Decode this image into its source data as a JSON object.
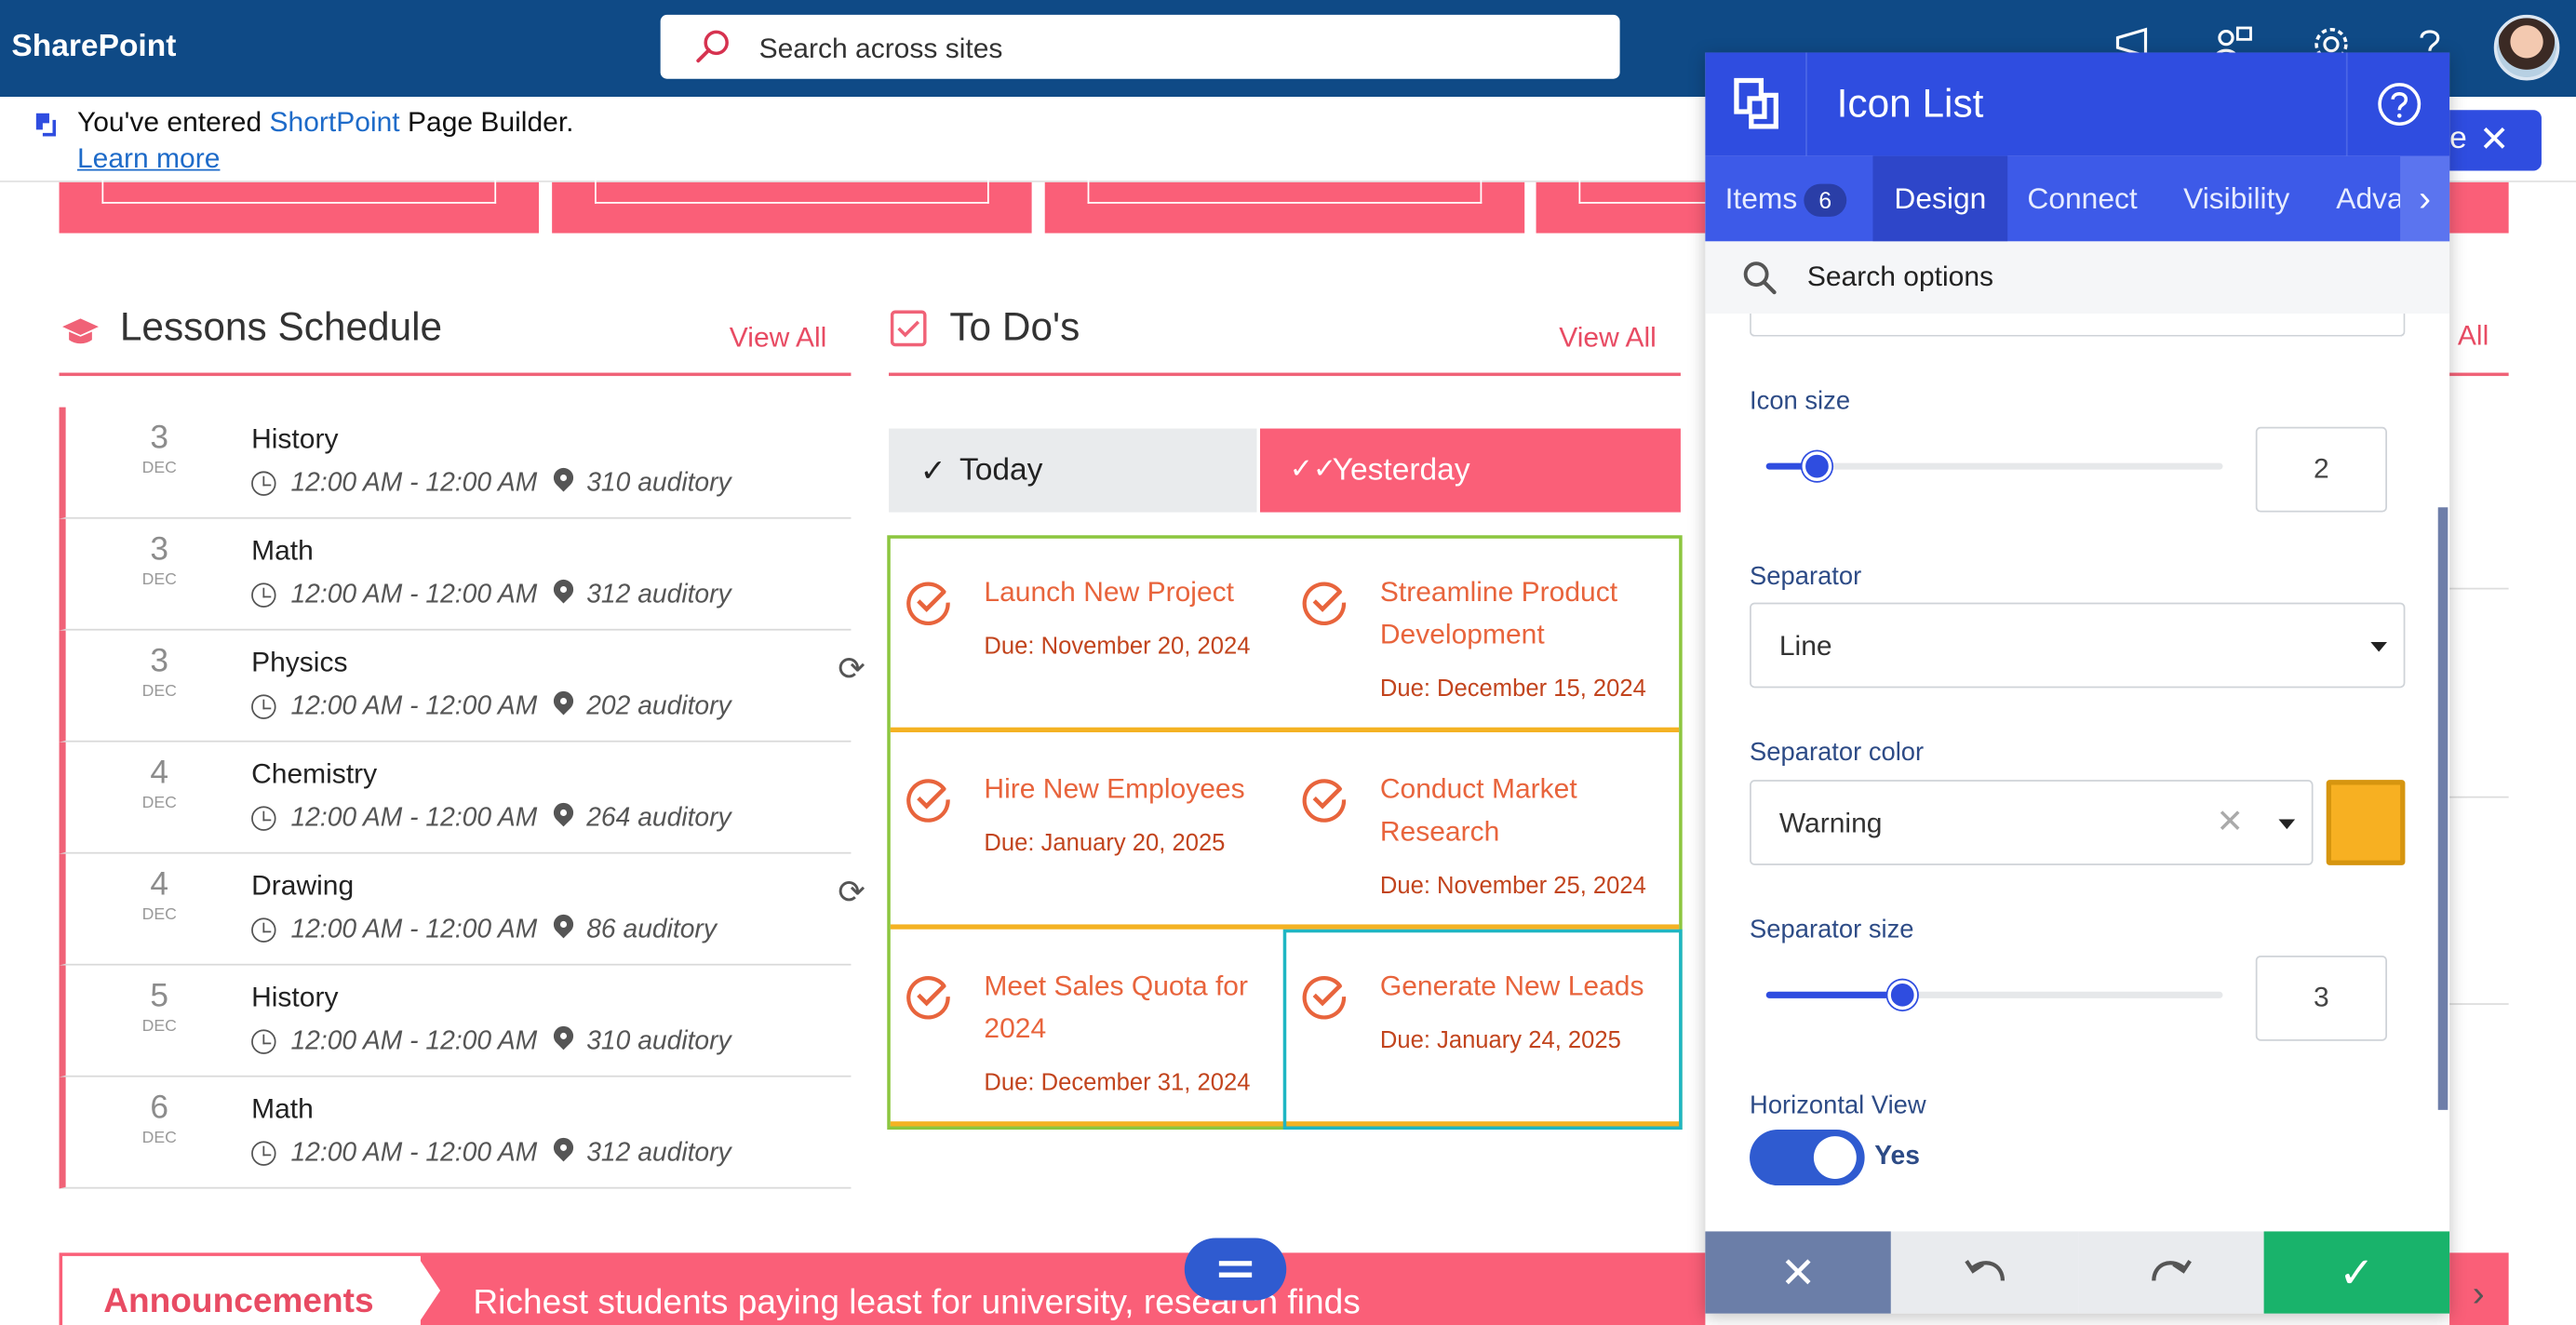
{
  "topbar": {
    "brand": "SharePoint",
    "search_placeholder": "Search across sites"
  },
  "notice": {
    "prefix": "You've entered ",
    "product": "ShortPoint",
    "suffix": " Page Builder.",
    "learn_more": "Learn more"
  },
  "lessons": {
    "title": "Lessons Schedule",
    "view_all": "View All",
    "items": [
      {
        "day": "3",
        "month": "DEC",
        "subject": "History",
        "time": "12:00 AM - 12:00 AM",
        "room": "310 auditory",
        "recurring": false
      },
      {
        "day": "3",
        "month": "DEC",
        "subject": "Math",
        "time": "12:00 AM - 12:00 AM",
        "room": "312 auditory",
        "recurring": false
      },
      {
        "day": "3",
        "month": "DEC",
        "subject": "Physics",
        "time": "12:00 AM - 12:00 AM",
        "room": "202 auditory",
        "recurring": true
      },
      {
        "day": "4",
        "month": "DEC",
        "subject": "Chemistry",
        "time": "12:00 AM - 12:00 AM",
        "room": "264 auditory",
        "recurring": false
      },
      {
        "day": "4",
        "month": "DEC",
        "subject": "Drawing",
        "time": "12:00 AM - 12:00 AM",
        "room": "86 auditory",
        "recurring": true
      },
      {
        "day": "5",
        "month": "DEC",
        "subject": "History",
        "time": "12:00 AM - 12:00 AM",
        "room": "310 auditory",
        "recurring": false
      },
      {
        "day": "6",
        "month": "DEC",
        "subject": "Math",
        "time": "12:00 AM - 12:00 AM",
        "room": "312 auditory",
        "recurring": false
      }
    ]
  },
  "todos": {
    "title": "To Do's",
    "view_all": "View All",
    "tab_today": "Today",
    "tab_yesterday": "Yesterday",
    "items": [
      {
        "title": "Launch New Project",
        "due": "Due: November 20, 2024"
      },
      {
        "title": "Streamline Product Development",
        "due": "Due: December 15, 2024"
      },
      {
        "title": "Hire New Employees",
        "due": "Due: January 20, 2025"
      },
      {
        "title": "Conduct Market Research",
        "due": "Due: November 25, 2024"
      },
      {
        "title": "Meet Sales Quota for 2024",
        "due": "Due: December 31, 2024"
      },
      {
        "title": "Generate New Leads",
        "due": "Due: January 24, 2025"
      }
    ]
  },
  "right_stub": {
    "view_all": "All",
    "close_label": "e"
  },
  "panel": {
    "title": "Icon List",
    "tabs": [
      {
        "label": "Items",
        "badge": "6"
      },
      {
        "label": "Design"
      },
      {
        "label": "Connect"
      },
      {
        "label": "Visibility"
      },
      {
        "label": "Adva"
      }
    ],
    "active_tab": "Design",
    "search_placeholder": "Search options",
    "icon_size": {
      "label": "Icon size",
      "value": "2",
      "fraction": 0.11
    },
    "separator": {
      "label": "Separator",
      "value": "Line"
    },
    "separator_color": {
      "label": "Separator color",
      "value": "Warning",
      "swatch": "#f7b022"
    },
    "separator_size": {
      "label": "Separator size",
      "value": "3",
      "fraction": 0.3
    },
    "horizontal_view": {
      "label": "Horizontal View",
      "value": "Yes",
      "on": true
    }
  },
  "announcements": {
    "label": "Announcements",
    "headline": "Richest students paying least for university, research finds"
  },
  "colors": {
    "brand_bar": "#0f4a86",
    "accent_pink": "#fa5f78",
    "panel_blue": "#2f4de0",
    "todo_orange": "#e8643c"
  }
}
